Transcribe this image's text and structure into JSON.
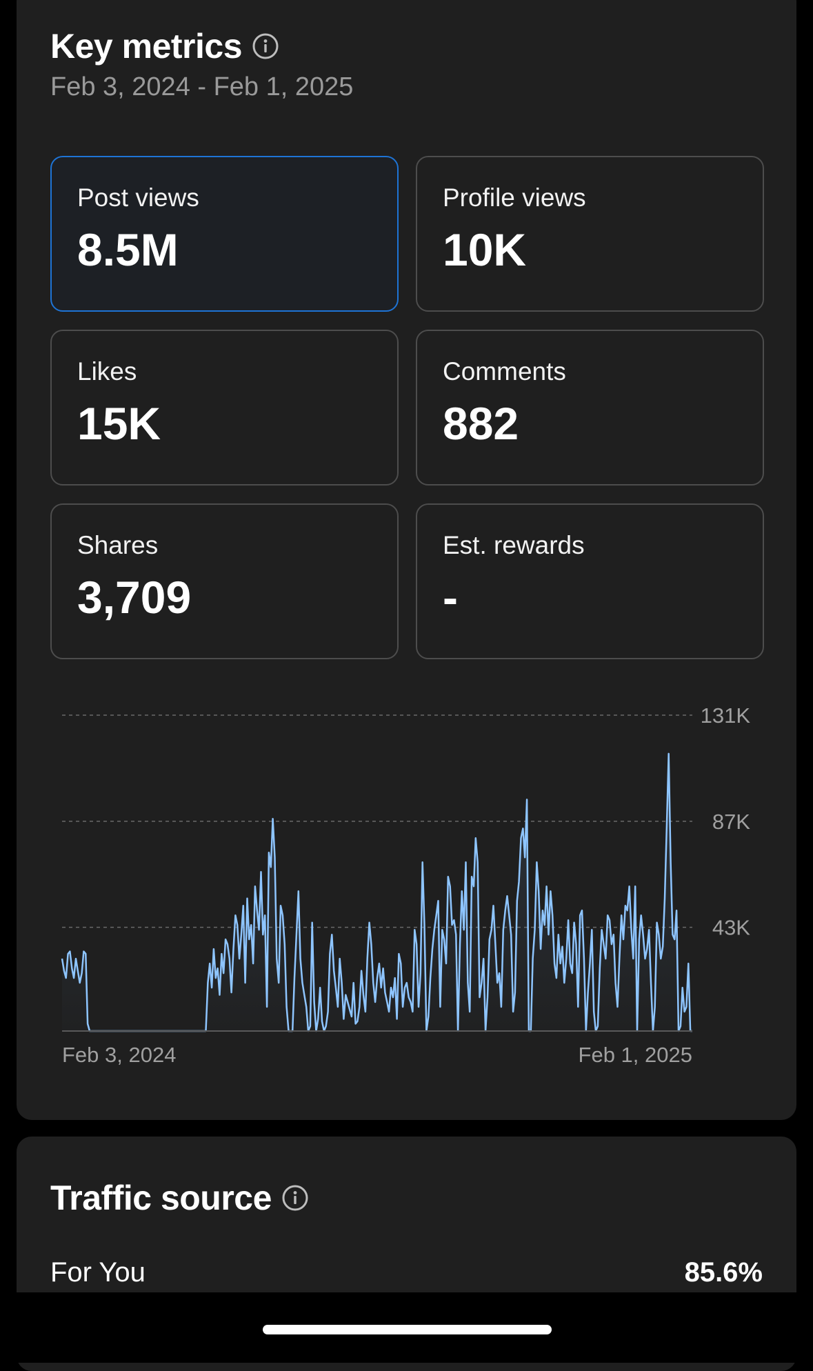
{
  "key_metrics": {
    "title": "Key metrics",
    "date_range": "Feb 3, 2024 - Feb 1, 2025",
    "tiles": [
      {
        "label": "Post views",
        "value": "8.5M",
        "selected": true
      },
      {
        "label": "Profile views",
        "value": "10K",
        "selected": false
      },
      {
        "label": "Likes",
        "value": "15K",
        "selected": false
      },
      {
        "label": "Comments",
        "value": "882",
        "selected": false
      },
      {
        "label": "Shares",
        "value": "3,709",
        "selected": false
      },
      {
        "label": "Est. rewards",
        "value": "-",
        "selected": false
      }
    ]
  },
  "chart_data": {
    "type": "line",
    "x_start_label": "Feb 3, 2024",
    "x_end_label": "Feb 1, 2025",
    "y_ticks": [
      {
        "value": 131000,
        "label": "131K"
      },
      {
        "value": 87000,
        "label": "87K"
      },
      {
        "value": 43000,
        "label": "43K"
      }
    ],
    "ylim": [
      0,
      131000
    ],
    "grid": true,
    "line_color": "#8ec5ff",
    "values": [
      30000,
      25000,
      22000,
      32000,
      33000,
      26000,
      22000,
      30000,
      25000,
      20000,
      24000,
      33000,
      32000,
      3000,
      0,
      0,
      0,
      0,
      0,
      0,
      0,
      0,
      0,
      0,
      0,
      0,
      0,
      0,
      0,
      0,
      0,
      0,
      0,
      0,
      0,
      0,
      0,
      0,
      0,
      0,
      0,
      0,
      0,
      0,
      0,
      0,
      0,
      0,
      0,
      0,
      0,
      0,
      0,
      0,
      0,
      0,
      0,
      0,
      0,
      0,
      0,
      0,
      0,
      0,
      0,
      0,
      0,
      0,
      0,
      0,
      0,
      0,
      0,
      0,
      20000,
      28000,
      18000,
      34000,
      22000,
      26000,
      15000,
      32000,
      24000,
      38000,
      36000,
      30000,
      16000,
      34000,
      48000,
      44000,
      30000,
      40000,
      52000,
      20000,
      55000,
      38000,
      44000,
      28000,
      60000,
      50000,
      42000,
      66000,
      40000,
      48000,
      10000,
      74000,
      68000,
      88000,
      72000,
      30000,
      20000,
      52000,
      48000,
      36000,
      10000,
      0,
      0,
      0,
      22000,
      40000,
      58000,
      30000,
      20000,
      15000,
      10000,
      0,
      2000,
      45000,
      12000,
      0,
      5000,
      18000,
      4000,
      0,
      2000,
      8000,
      32000,
      40000,
      25000,
      18000,
      10000,
      30000,
      20000,
      5000,
      15000,
      12000,
      9000,
      6000,
      20000,
      3000,
      4000,
      10000,
      25000,
      15000,
      8000,
      30000,
      45000,
      36000,
      20000,
      12000,
      22000,
      28000,
      18000,
      26000,
      16000,
      12000,
      8000,
      18000,
      14000,
      22000,
      5000,
      32000,
      28000,
      10000,
      18000,
      20000,
      14000,
      12000,
      8000,
      42000,
      36000,
      10000,
      24000,
      70000,
      44000,
      0,
      6000,
      22000,
      34000,
      42000,
      48000,
      54000,
      10000,
      42000,
      38000,
      28000,
      64000,
      60000,
      44000,
      46000,
      40000,
      0,
      36000,
      58000,
      42000,
      70000,
      20000,
      8000,
      64000,
      60000,
      80000,
      70000,
      14000,
      20000,
      30000,
      0,
      14000,
      38000,
      42000,
      52000,
      36000,
      20000,
      24000,
      10000,
      42000,
      50000,
      56000,
      48000,
      40000,
      8000,
      16000,
      54000,
      62000,
      80000,
      84000,
      72000,
      96000,
      0,
      0,
      30000,
      42000,
      70000,
      58000,
      34000,
      50000,
      44000,
      60000,
      40000,
      58000,
      48000,
      28000,
      22000,
      40000,
      28000,
      35000,
      20000,
      30000,
      46000,
      28000,
      24000,
      45000,
      36000,
      10000,
      48000,
      50000,
      30000,
      0,
      16000,
      28000,
      42000,
      8000,
      0,
      2000,
      26000,
      42000,
      36000,
      30000,
      48000,
      46000,
      36000,
      40000,
      20000,
      10000,
      30000,
      48000,
      38000,
      52000,
      50000,
      60000,
      42000,
      30000,
      60000,
      0,
      38000,
      48000,
      40000,
      30000,
      34000,
      42000,
      20000,
      0,
      10000,
      45000,
      40000,
      30000,
      35000,
      55000,
      85000,
      115000,
      70000,
      40000,
      38000,
      50000,
      0,
      2000,
      18000,
      8000,
      10000,
      28000,
      0,
      0
    ]
  },
  "traffic_source": {
    "title": "Traffic source",
    "rows": [
      {
        "label": "For You",
        "value": "85.6%"
      }
    ]
  }
}
